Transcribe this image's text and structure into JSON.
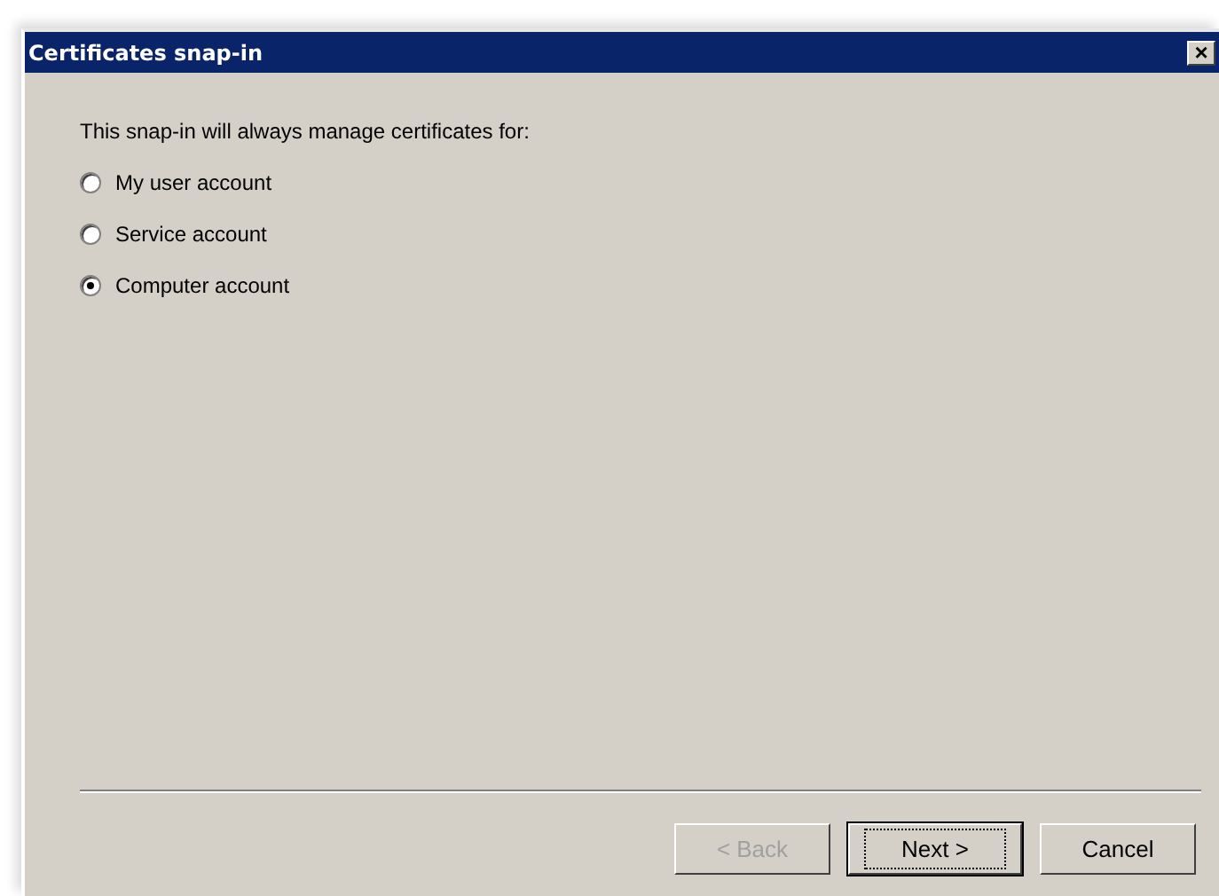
{
  "window": {
    "title": "Certificates snap-in",
    "close": "×"
  },
  "prompt": "This snap-in will always manage certificates for:",
  "options": [
    {
      "label": "My user account",
      "selected": false
    },
    {
      "label": "Service account",
      "selected": false
    },
    {
      "label": "Computer account",
      "selected": true
    }
  ],
  "buttons": [
    {
      "label": "< Back",
      "disabled": true,
      "default": false
    },
    {
      "label": "Next >",
      "disabled": false,
      "default": true
    },
    {
      "label": "Cancel",
      "disabled": false,
      "default": false
    }
  ]
}
